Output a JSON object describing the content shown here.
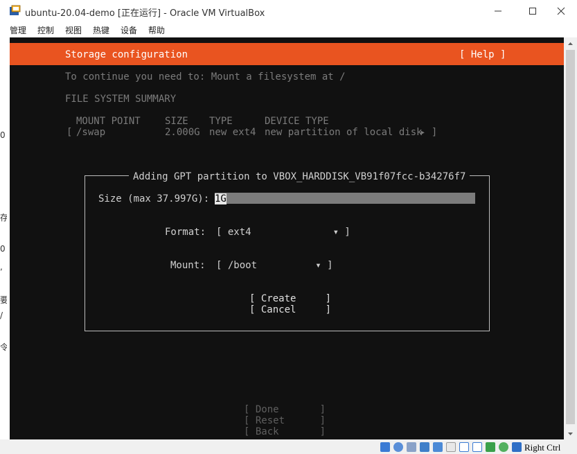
{
  "window": {
    "title": "ubuntu-20.04-demo [正在运行] - Oracle VM VirtualBox"
  },
  "menubar": {
    "items": [
      "管理",
      "控制",
      "视图",
      "热键",
      "设备",
      "帮助"
    ]
  },
  "installer": {
    "header_title": "Storage configuration",
    "help_label": "[ Help ]",
    "instruction": "To continue you need to: Mount a filesystem at /",
    "summary_heading": "FILE SYSTEM SUMMARY",
    "columns": {
      "mount_point": "MOUNT POINT",
      "size": "SIZE",
      "type": "TYPE",
      "device_type": "DEVICE TYPE"
    },
    "rows": [
      {
        "bracket_open": "[",
        "mount_point": "/swap",
        "size": "2.000G",
        "type": "new ext4",
        "device_type": "new partition of local disk",
        "arrow": "▸ ]"
      }
    ],
    "dialog": {
      "title": "Adding GPT partition to VBOX_HARDDISK_VB91f07fcc-b34276f7",
      "size_label": "Size (max 37.997G):",
      "size_value": "1G",
      "format_label": "Format:",
      "format_value": "[ ext4              ▾ ]",
      "mount_label": "Mount:",
      "mount_value": "[ /boot          ▾ ]",
      "create_label": "[ Create     ]",
      "cancel_label": "[ Cancel     ]"
    },
    "footer": {
      "done_label": "[ Done       ]",
      "reset_label": "[ Reset      ]",
      "back_label": "[ Back       ]"
    }
  },
  "statusbar": {
    "host_key": "Right Ctrl"
  },
  "left_edge_fragments": [
    "0",
    "存",
    "0",
    ",",
    "要",
    "/",
    "令"
  ]
}
